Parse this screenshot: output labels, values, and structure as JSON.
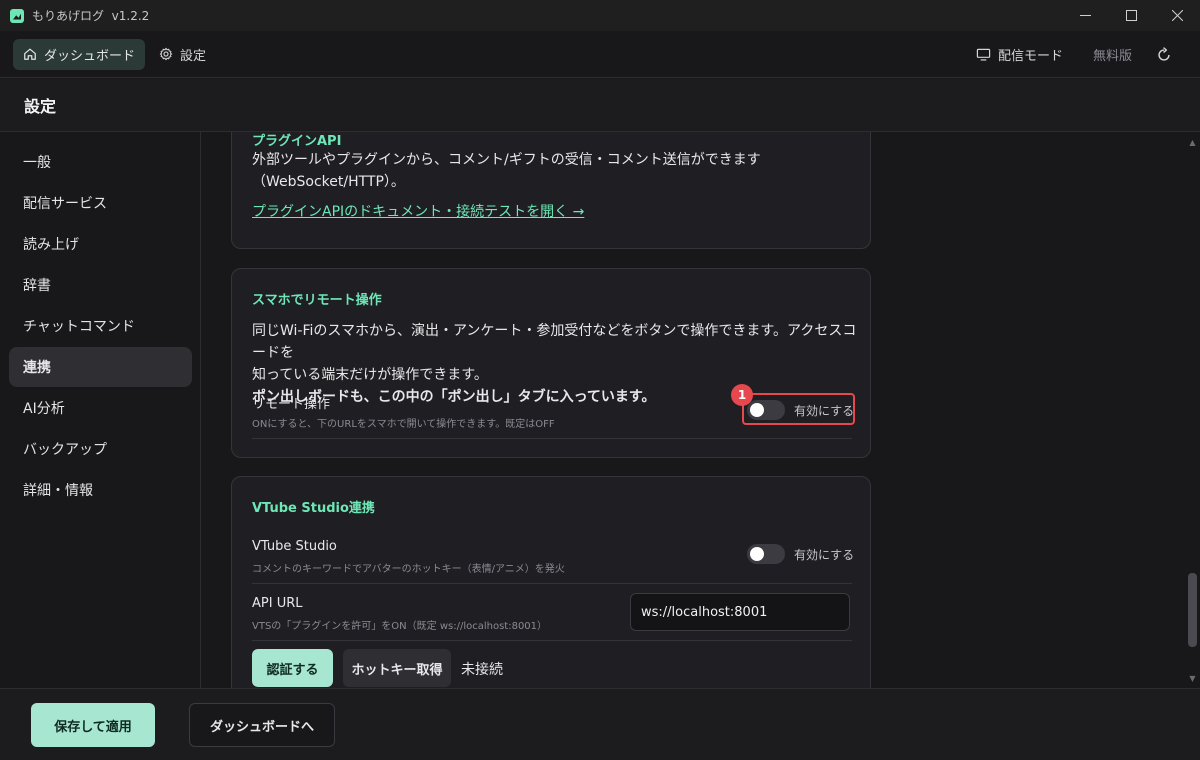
{
  "window": {
    "title": "もりあげログ",
    "version": "v1.2.2"
  },
  "topnav": {
    "dashboard_label": "ダッシュボード",
    "settings_label": "設定",
    "stream_mode_label": "配信モード",
    "free_label": "無料版"
  },
  "page": {
    "title": "設定"
  },
  "sidebar": {
    "items": [
      {
        "label": "一般"
      },
      {
        "label": "配信サービス"
      },
      {
        "label": "読み上げ"
      },
      {
        "label": "辞書"
      },
      {
        "label": "チャットコマンド"
      },
      {
        "label": "連携",
        "active": true
      },
      {
        "label": "AI分析"
      },
      {
        "label": "バックアップ"
      },
      {
        "label": "詳細・情報"
      }
    ]
  },
  "plugin_api": {
    "title": "プラグインAPI",
    "desc_line1": "外部ツールやプラグインから、コメント/ギフトの受信・コメント送信ができます",
    "desc_line2": "（WebSocket/HTTP）。",
    "link": "プラグインAPIのドキュメント・接続テストを開く →"
  },
  "remote": {
    "title": "スマホでリモート操作",
    "desc_line1": "同じWi-Fiのスマホから、演出・アンケート・参加受付などをボタンで操作できます。アクセスコードを",
    "desc_line2": "知っている端末だけが操作できます。",
    "desc_bold": "ポン出しボードも、この中の「ポン出し」タブに入っています。",
    "setting_label": "リモート操作",
    "setting_help": "ONにすると、下のURLをスマホで開いて操作できます。既定はOFF",
    "toggle_label": "有効にする",
    "toggle_on": false,
    "badge": "1"
  },
  "vtube": {
    "title": "VTube Studio連携",
    "setting_label": "VTube Studio",
    "setting_help": "コメントのキーワードでアバターのホットキー（表情/アニメ）を発火",
    "toggle_label": "有効にする",
    "toggle_on": false,
    "api_label": "API URL",
    "api_help": "VTSの「プラグインを許可」をON（既定 ws://localhost:8001）",
    "api_value": "ws://localhost:8001",
    "auth_button": "認証する",
    "hotkey_button": "ホットキー取得",
    "status": "未接続"
  },
  "footer": {
    "save_label": "保存して適用",
    "dashboard_label": "ダッシュボードへ"
  },
  "colors": {
    "accent": "#6ee7b7",
    "primary_button": "#a7e6d0",
    "highlight": "#e5484d"
  }
}
